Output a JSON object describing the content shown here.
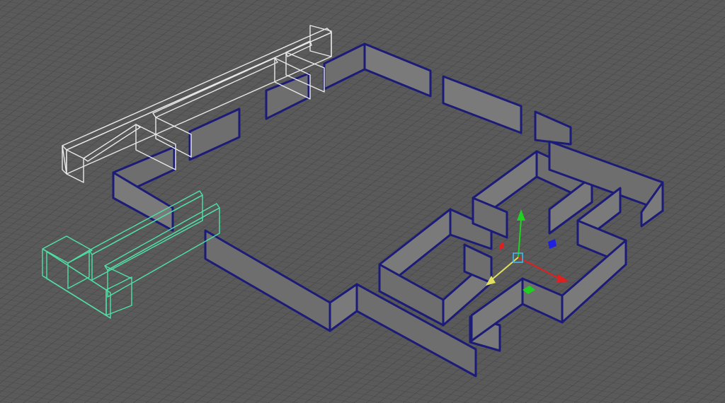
{
  "viewport": {
    "name": "perspective-3d-viewport",
    "background": "#5a5a5a",
    "grid_color": "#3d3d3d"
  },
  "colors": {
    "selected_blue": "#1c1c78",
    "wall_face": "#6b6b6b",
    "wall_face_dark": "#595959",
    "wire_white": "#e8e8e8",
    "wire_green": "#4fe0a6",
    "gizmo_x": "#e02020",
    "gizmo_y": "#20d020",
    "gizmo_z": "#2020e0",
    "gizmo_center": "#40b8e8",
    "gizmo_free": "#e0e060"
  },
  "objects": [
    {
      "name": "wall-group-white-wireframe",
      "display": "wireframe",
      "state": "unselected"
    },
    {
      "name": "wall-group-green-wireframe",
      "display": "wireframe",
      "state": "highlighted"
    },
    {
      "name": "wall-group-selected-shaded",
      "display": "shaded",
      "state": "selected"
    }
  ],
  "manipulator": {
    "type": "move-tool-gizmo",
    "axes": [
      "x-axis",
      "y-axis",
      "z-axis"
    ],
    "icon": "move-manipulator-icon"
  }
}
